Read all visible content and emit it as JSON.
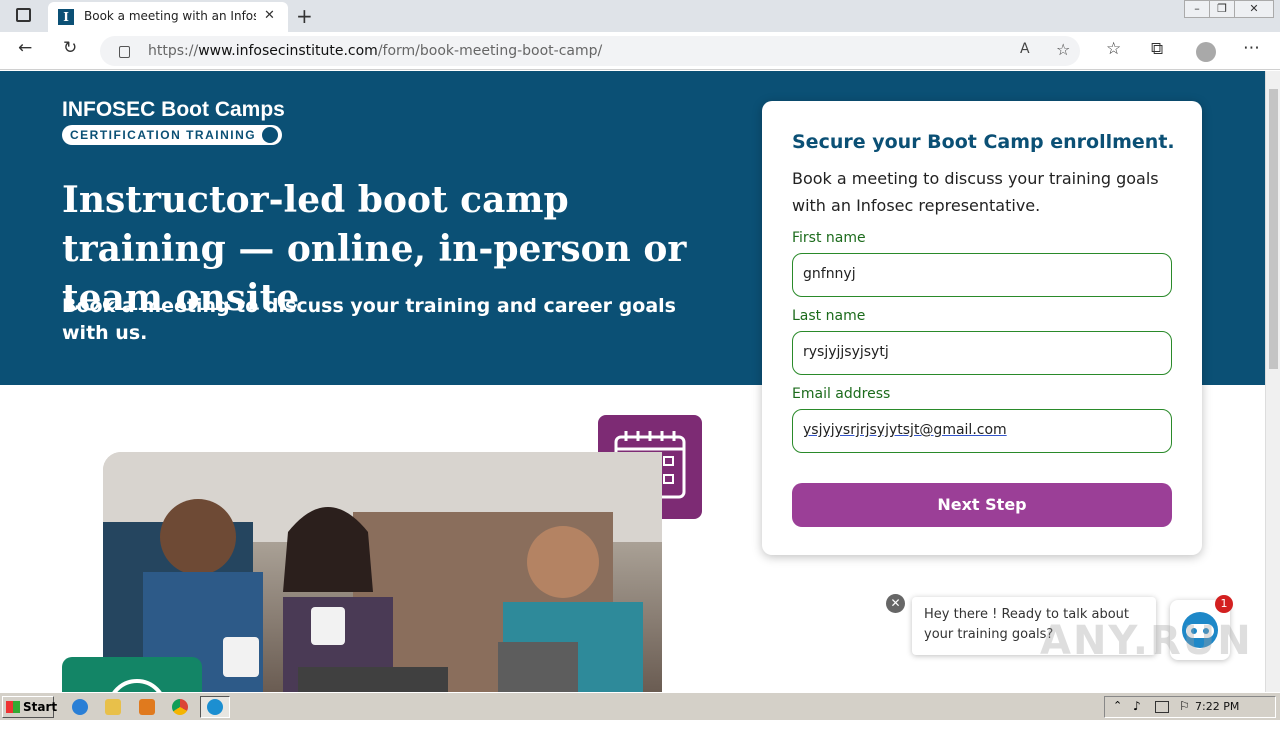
{
  "browser": {
    "tab_title": "Book a meeting with an Infosec b",
    "tab_favicon": "I",
    "url_prefix": "https://",
    "url_domain": "www.infosecinstitute.com",
    "url_path": "/form/book-meeting-boot-camp/"
  },
  "hero": {
    "logo_line1": "INFOSEC Boot Camps",
    "logo_line2": "CERTIFICATION TRAINING",
    "headline": "Instructor-led boot camp training — online, in-person or team onsite",
    "subhead": "Book a meeting to discuss your training and career goals with us."
  },
  "form": {
    "title": "Secure your Boot Camp enrollment.",
    "description": "Book a meeting to discuss your training goals with an Infosec representative.",
    "first_name_label": "First name",
    "first_name_value": "gnfnnyj",
    "last_name_label": "Last name",
    "last_name_value": "rysjyjjsyjsytj",
    "email_label": "Email address",
    "email_value": "ysjyjysrjrjsyjytsjt@gmail.com",
    "next_label": "Next Step"
  },
  "chat": {
    "message": "Hey there ! Ready to talk about your training goals?",
    "badge_count": "1"
  },
  "watermark": "ANY.RUN",
  "taskbar": {
    "start_label": "Start",
    "clock": "7:22 PM"
  },
  "colors": {
    "brand_blue": "#0b5075",
    "button_purple": "#9b3f97",
    "input_green": "#2a8a2a"
  }
}
